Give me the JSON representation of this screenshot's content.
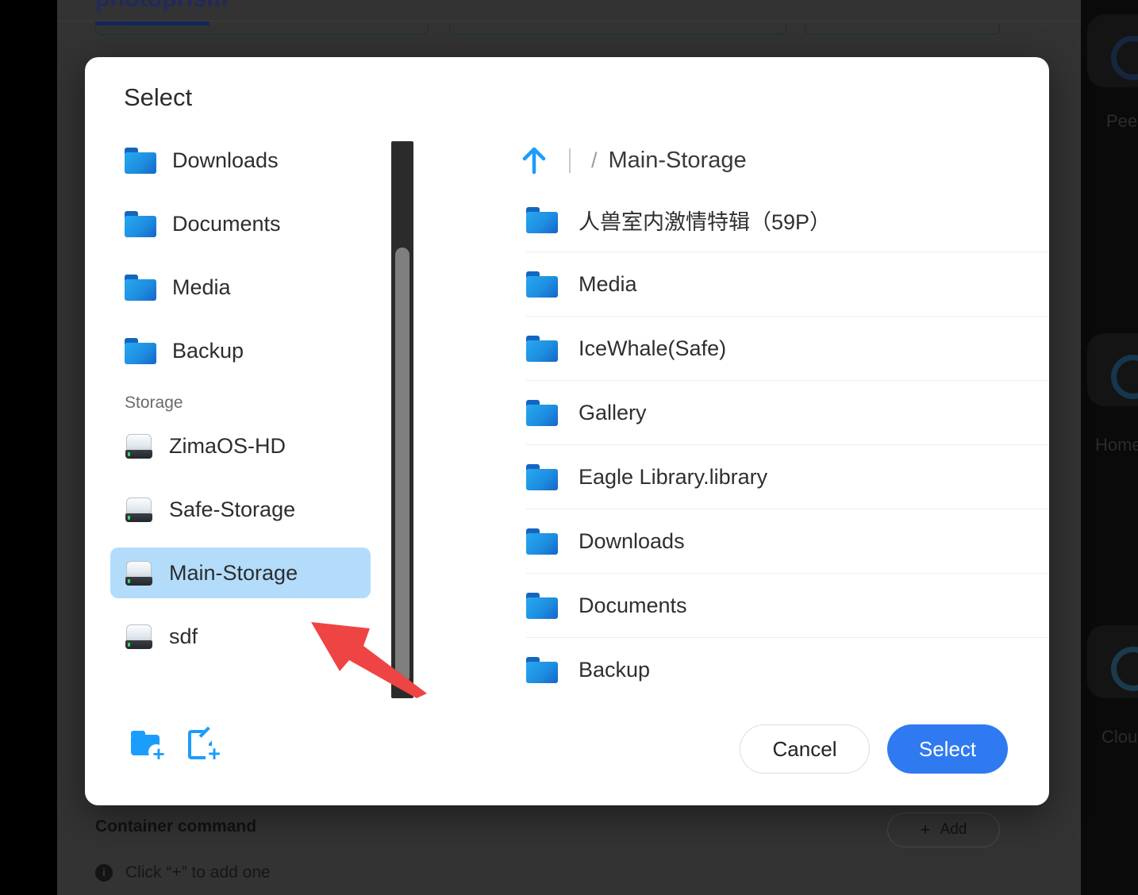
{
  "background": {
    "app_title": "photoprism",
    "section_title": "Container command",
    "hint_text": "Click “+” to add one",
    "hint_icon": "info-icon",
    "add_button_label": "Add",
    "add_button_plus": "+",
    "tiles": [
      {
        "label": "Pee"
      },
      {
        "label": "Home"
      },
      {
        "label": "Clou"
      }
    ]
  },
  "dialog": {
    "title": "Select",
    "sidebar": {
      "shortcuts": [
        {
          "label": "Downloads",
          "icon": "folder-icon"
        },
        {
          "label": "Documents",
          "icon": "folder-icon"
        },
        {
          "label": "Media",
          "icon": "folder-icon"
        },
        {
          "label": "Backup",
          "icon": "folder-icon"
        }
      ],
      "group_title": "Storage",
      "storage": [
        {
          "label": "ZimaOS-HD",
          "icon": "drive-icon",
          "selected": false
        },
        {
          "label": "Safe-Storage",
          "icon": "drive-icon",
          "selected": false
        },
        {
          "label": "Main-Storage",
          "icon": "drive-icon",
          "selected": true
        },
        {
          "label": "sdf",
          "icon": "drive-icon",
          "selected": false
        }
      ]
    },
    "breadcrumb": {
      "up_icon": "arrow-up-icon",
      "separator": "/",
      "current": "Main-Storage"
    },
    "files": [
      {
        "name": "人兽室内激情特辑（59P）",
        "icon": "folder-icon"
      },
      {
        "name": "Media",
        "icon": "folder-icon"
      },
      {
        "name": "IceWhale(Safe)",
        "icon": "folder-icon"
      },
      {
        "name": "Gallery",
        "icon": "folder-icon"
      },
      {
        "name": "Eagle Library.library",
        "icon": "folder-icon"
      },
      {
        "name": "Downloads",
        "icon": "folder-icon"
      },
      {
        "name": "Documents",
        "icon": "folder-icon"
      },
      {
        "name": "Backup",
        "icon": "folder-icon"
      }
    ],
    "footer": {
      "new_folder_icon": "new-folder-icon",
      "new_file_icon": "new-file-icon",
      "cancel_label": "Cancel",
      "select_label": "Select"
    }
  },
  "annotation": {
    "arrow_color": "#ef4444"
  },
  "colors": {
    "accent_blue": "#2f7af0",
    "folder_blue": "#1e8ee0",
    "selected_row": "#b3dcfb",
    "dialog_bg": "#ffffff",
    "page_bg": "#333333"
  }
}
